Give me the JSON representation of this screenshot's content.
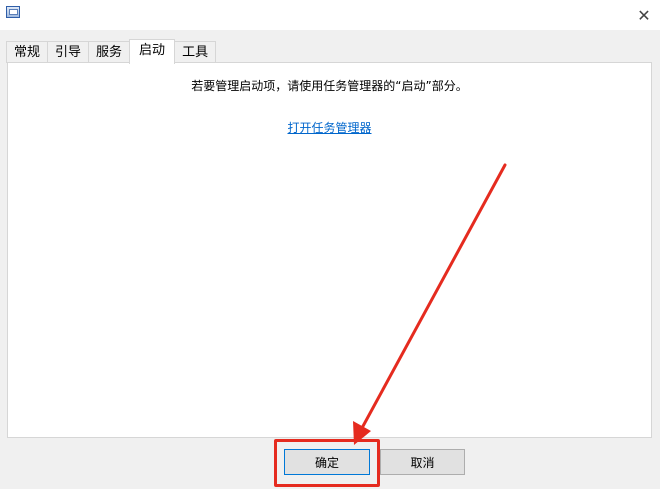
{
  "window": {
    "close_glyph": "✕"
  },
  "tabs": [
    {
      "label": "常规",
      "active": false
    },
    {
      "label": "引导",
      "active": false
    },
    {
      "label": "服务",
      "active": false
    },
    {
      "label": "启动",
      "active": true
    },
    {
      "label": "工具",
      "active": false
    }
  ],
  "panel": {
    "info_text": "若要管理启动项，请使用任务管理器的“启动”部分。",
    "link_text": "打开任务管理器"
  },
  "buttons": {
    "ok_label": "确定",
    "cancel_label": "取消"
  },
  "annotation": {
    "color": "#e52b1f"
  },
  "colors": {
    "link": "#0066cc",
    "focus_border": "#0078d7"
  }
}
